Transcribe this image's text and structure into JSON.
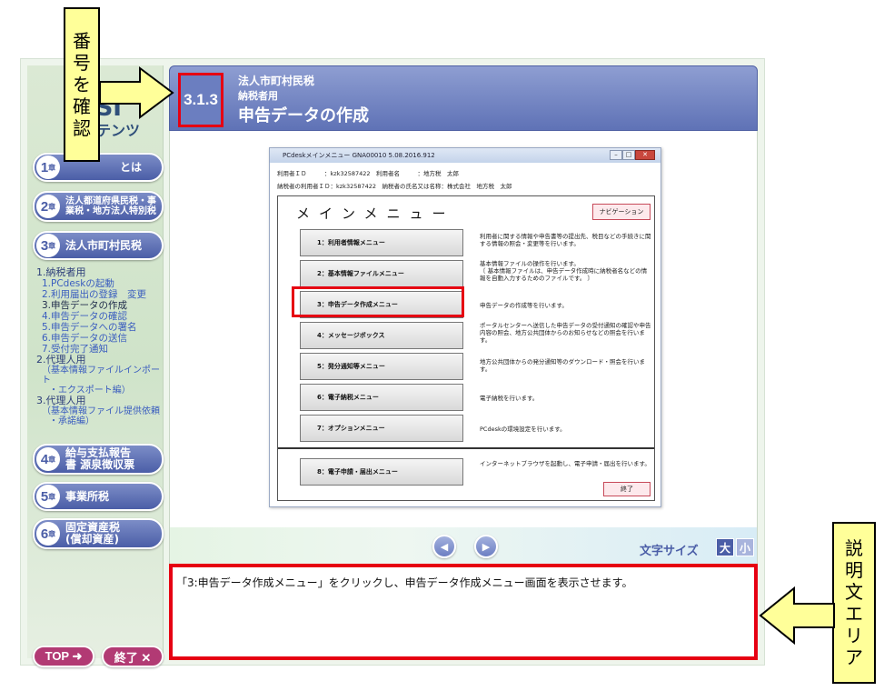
{
  "sidebar": {
    "logo_l1": "CSI",
    "logo_l2": "テンツ",
    "chapters": [
      {
        "num": "1",
        "label": "とは"
      },
      {
        "num": "2",
        "label": "法人都道府県民税・事業税・地方法人特別税"
      },
      {
        "num": "3",
        "label": "法人市町村民税"
      },
      {
        "num": "4",
        "label": "給与支払報告書 源泉徴収票"
      },
      {
        "num": "5",
        "label": "事業所税"
      },
      {
        "num": "6",
        "label": "固定資産税 (償却資産)"
      }
    ],
    "chapter_suffix": "章",
    "subnav": {
      "h1": "1.納税者用",
      "items": [
        "1.PCdeskの起動",
        "2.利用届出の登録　変更",
        "3.申告データの作成",
        "4.申告データの確認",
        "5.申告データへの署名",
        "6.申告データの送信",
        "7.受付完了通知"
      ],
      "h2": "2.代理人用",
      "h2_sub1": "（基本情報ファイルインポート",
      "h2_sub2": "・エクスポート編）",
      "h3": "3.代理人用",
      "h3_sub1": "（基本情報ファイル提供依頼",
      "h3_sub2": "・承諾編）"
    },
    "top_label": "TOP ➜",
    "exit_label": "終了 ✕"
  },
  "header": {
    "section_number": "3.1.3",
    "line1": "法人市町村民税",
    "line2": "納税者用",
    "title": "申告データの作成"
  },
  "window": {
    "title": "PCdeskメインメニュー GNA00010 5.08.2016.912",
    "user_id_label": "利用者ＩＤ　　　：kzk32587422　利用者名　　　：地方税　太郎",
    "taxpayer_line": "納税者の利用者ＩＤ：kzk32587422　納税者の氏名又は名称：株式会社　地方税　太郎",
    "menu_title": "メインメニュー",
    "navigation_label": "ナビゲーション",
    "menus": [
      {
        "label": "1：利用者情報メニュー",
        "desc": "利用者に関する情報や申告書等の提出先、税目などの手続きに関する情報の照会・変更等を行います。"
      },
      {
        "label": "2：基本情報ファイルメニュー",
        "desc": "基本情報ファイルの操作を行います。\n〔 基本情報ファイルは、申告データ作成時に納税者名などの情報を自動入力するためのファイルです。 〕"
      },
      {
        "label": "3：申告データ作成メニュー",
        "desc": "申告データの作成等を行います。"
      },
      {
        "label": "4：メッセージボックス",
        "desc": "ポータルセンターへ送信した申告データの受付通知の確認や申告内容の照会、地方公共団体からのお知らせなどの照会を行います。"
      },
      {
        "label": "5：発分通知等メニュー",
        "desc": "地方公共団体からの発分通知等のダウンロード・照会を行います。"
      },
      {
        "label": "6：電子納税メニュー",
        "desc": "電子納税を行います。"
      },
      {
        "label": "7：オプションメニュー",
        "desc": "PCdeskの環境設定を行います。"
      },
      {
        "label": "8：電子申請・届出メニュー",
        "desc": "インターネットブラウザを起動し、電子申請・届出を行います。"
      }
    ],
    "end_label": "終了"
  },
  "navbar": {
    "prev": "◀",
    "next": "▶",
    "font_size_label": "文字サイズ",
    "large": "大",
    "small": "小"
  },
  "description": "「3:申告データ作成メニュー」をクリックし、申告データ作成メニュー画面を表示させます。",
  "callouts": {
    "number": [
      "番",
      "号",
      "を",
      "確",
      "認"
    ],
    "desc_area": [
      "説",
      "明",
      "文",
      "エ",
      "リ",
      "ア"
    ]
  }
}
